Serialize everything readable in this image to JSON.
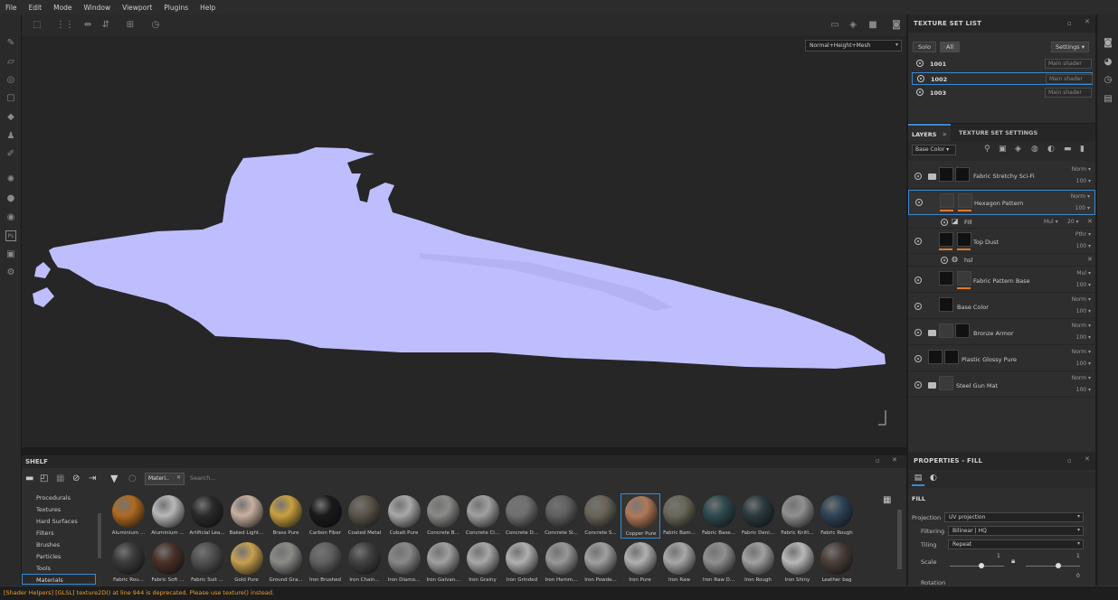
{
  "menu": [
    "File",
    "Edit",
    "Mode",
    "Window",
    "Viewport",
    "Plugins",
    "Help"
  ],
  "viewport": {
    "mode_select": "Normal+Height+Mesh"
  },
  "texture_set_list": {
    "title": "TEXTURE SET LIST",
    "solo": "Solo",
    "all": "All",
    "settings": "Settings",
    "sets": [
      {
        "name": "1001",
        "shader": "Main shader"
      },
      {
        "name": "1002",
        "shader": "Main shader"
      },
      {
        "name": "1003",
        "shader": "Main shader"
      }
    ]
  },
  "layers": {
    "tab_layers": "LAYERS",
    "tab_settings": "TEXTURE SET SETTINGS",
    "channel": "Base Color",
    "rows": [
      {
        "name": "Fabric Stretchy Sci-Fi",
        "blend": "Norm",
        "opacity": "100"
      },
      {
        "name": "Hexagon Pattern",
        "blend": "Norm",
        "opacity": "100"
      },
      {
        "name": "Fill",
        "blend": "Mul",
        "opacity": "20"
      },
      {
        "name": "Top Dust",
        "blend": "Pthr",
        "opacity": "100"
      },
      {
        "name": "hsl",
        "blend": "",
        "opacity": ""
      },
      {
        "name": "Fabric Pattern Base",
        "blend": "Mul",
        "opacity": "100"
      },
      {
        "name": "Base Color",
        "blend": "Norm",
        "opacity": "100"
      },
      {
        "name": "Bronze Armor",
        "blend": "Norm",
        "opacity": "100"
      },
      {
        "name": "Plastic Glossy Pure",
        "blend": "Norm",
        "opacity": "100"
      },
      {
        "name": "Steel Gun Mat",
        "blend": "Norm",
        "opacity": "100"
      }
    ]
  },
  "properties": {
    "title": "PROPERTIES - FILL",
    "section": "FILL",
    "projection_label": "Projection",
    "projection_value": "UV projection",
    "filtering_label": "Filtering",
    "filtering_value": "Bilinear | HQ",
    "tiling_label": "Tiling",
    "tiling_value": "Repeat",
    "scale_label": "Scale",
    "scale_value_1": "1",
    "scale_value_2": "1",
    "rotation_label": "Rotation",
    "rotation_value": "0"
  },
  "shelf": {
    "title": "SHELF",
    "filter_chip": "Materi..",
    "search_placeholder": "Search...",
    "categories": [
      "Procedurals",
      "Textures",
      "Hard Surfaces",
      "Filters",
      "Brushes",
      "Particles",
      "Tools",
      "Materials"
    ],
    "selected_category": "Materials",
    "materials_row1": [
      {
        "name": "Aluminium ...",
        "color": "#b06a20"
      },
      {
        "name": "Aluminium ...",
        "color": "#b8b8b8"
      },
      {
        "name": "Artificial Lea...",
        "color": "#2a2a2a"
      },
      {
        "name": "Baked Light...",
        "color": "#c8b0a0"
      },
      {
        "name": "Brass Pure",
        "color": "#c8a040"
      },
      {
        "name": "Carbon Fiber",
        "color": "#1a1a1a"
      },
      {
        "name": "Coated Metal",
        "color": "#5a5448"
      },
      {
        "name": "Cobalt Pure",
        "color": "#a8a8a8"
      },
      {
        "name": "Concrete B...",
        "color": "#8a8a88"
      },
      {
        "name": "Concrete Cl...",
        "color": "#a0a0a0"
      },
      {
        "name": "Concrete D...",
        "color": "#707070"
      },
      {
        "name": "Concrete Sl...",
        "color": "#606060"
      },
      {
        "name": "Concrete S...",
        "color": "#686458"
      },
      {
        "name": "Copper Pure",
        "color": "#b07858"
      },
      {
        "name": "Fabric Bam...",
        "color": "#6a6858"
      },
      {
        "name": "Fabric Base...",
        "color": "#2e4a50"
      },
      {
        "name": "Fabric Deni...",
        "color": "#2a3a3e"
      },
      {
        "name": "Fabric Knitt...",
        "color": "#909090"
      },
      {
        "name": "Fabric Rough",
        "color": "#2e4458"
      }
    ],
    "materials_row2": [
      {
        "name": "Fabric Rou...",
        "color": "#3a3a3a"
      },
      {
        "name": "Fabric Soft ...",
        "color": "#4a3028"
      },
      {
        "name": "Fabric Suit ...",
        "color": "#505050"
      },
      {
        "name": "Gold Pure",
        "color": "#c8a050"
      },
      {
        "name": "Ground Gra...",
        "color": "#8a8a86"
      },
      {
        "name": "Iron Brushed",
        "color": "#606060"
      },
      {
        "name": "Iron Chain...",
        "color": "#404040"
      },
      {
        "name": "Iron Diamo...",
        "color": "#888888"
      },
      {
        "name": "Iron Galvan...",
        "color": "#a0a0a0"
      },
      {
        "name": "Iron Grainy",
        "color": "#a8a8a8"
      },
      {
        "name": "Iron Grinded",
        "color": "#b0b0b0"
      },
      {
        "name": "Iron Hamm...",
        "color": "#989898"
      },
      {
        "name": "Iron Powde...",
        "color": "#a0a0a0"
      },
      {
        "name": "Iron Pure",
        "color": "#b0b0b0"
      },
      {
        "name": "Iron Raw",
        "color": "#a8a8a8"
      },
      {
        "name": "Iron Raw D...",
        "color": "#909090"
      },
      {
        "name": "Iron Rough",
        "color": "#a0a0a0"
      },
      {
        "name": "Iron Shiny",
        "color": "#b8b8b8"
      },
      {
        "name": "Leather bag",
        "color": "#4a3e38"
      }
    ]
  },
  "status_message": "[Shader Helpers] [GLSL] texture2D() at line 944 is deprecated. Please use texture() instead."
}
